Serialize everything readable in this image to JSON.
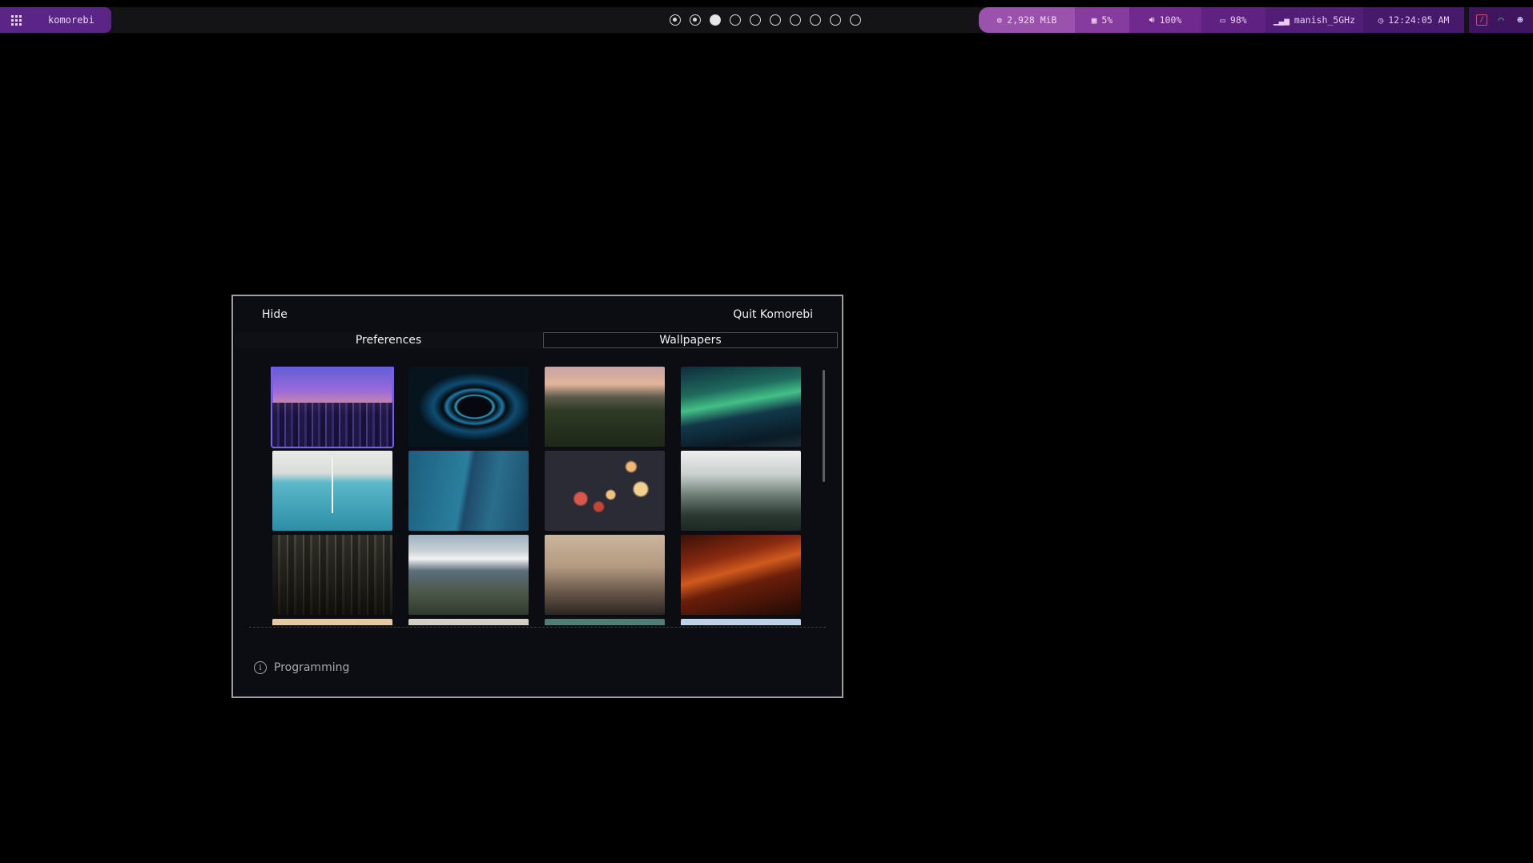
{
  "topbar": {
    "app_name": "komorebi",
    "workspaces": [
      "occupied",
      "occupied",
      "active",
      "empty",
      "empty",
      "empty",
      "empty",
      "empty",
      "empty",
      "empty"
    ],
    "memory": "2,928 MiB",
    "cpu": "5%",
    "volume": "100%",
    "battery": "98%",
    "network": "manish_5GHz",
    "clock": "12:24:05 AM",
    "tray_icons": [
      "pdf-app-icon",
      "wifi-icon",
      "discord-icon"
    ]
  },
  "dialog": {
    "hide_label": "Hide",
    "quit_label": "Quit Komorebi",
    "tabs": {
      "preferences": "Preferences",
      "wallpapers": "Wallpapers"
    },
    "selected_tab": "Wallpapers",
    "wallpapers": [
      {
        "name": "city-night-wallpaper",
        "selected": true
      },
      {
        "name": "blue-swirl-wallpaper",
        "selected": false
      },
      {
        "name": "forest-hills-sunset-wallpaper",
        "selected": false
      },
      {
        "name": "aurora-wallpaper",
        "selected": false
      },
      {
        "name": "beach-pier-aerial-wallpaper",
        "selected": false
      },
      {
        "name": "ocean-wave-wallpaper",
        "selected": false
      },
      {
        "name": "bokeh-lights-wallpaper",
        "selected": false
      },
      {
        "name": "misty-pine-forest-wallpaper",
        "selected": false
      },
      {
        "name": "foggy-woods-wallpaper",
        "selected": false
      },
      {
        "name": "matterhorn-wallpaper",
        "selected": false
      },
      {
        "name": "foggy-pier-wallpaper",
        "selected": false
      },
      {
        "name": "arrow-lights-wallpaper",
        "selected": false
      }
    ],
    "info_text": "Programming"
  },
  "colors": {
    "accent": "#7a5cf0",
    "left_pill": "#5b2487",
    "status_bar": "#9a52ac"
  }
}
